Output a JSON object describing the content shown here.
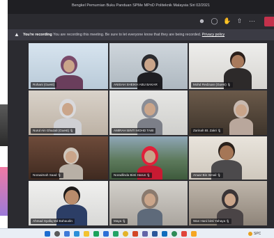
{
  "window": {
    "title": "Bengkel Pemurnian Buku Panduan SPMe MPnD Politeknik Malaysia Siri 02/2021"
  },
  "toolbar": {
    "icons": [
      "people-icon",
      "chat-icon",
      "hand-icon",
      "share-icon",
      "more-icon"
    ]
  },
  "banner": {
    "strong": "You're recording",
    "message": "You are recording this meeting. Be sure to let everyone know that they are being recorded.",
    "link": "Privacy policy"
  },
  "participants": [
    {
      "name": "Rohani (Guest)",
      "muted": false
    },
    {
      "name": "ANISAH SHEIKH ABU BAKAR",
      "muted": false
    },
    {
      "name": "Mohd Redzuan (Guest)",
      "muted": true
    },
    {
      "name": "Nurul Ain Ghazali (Guest)",
      "muted": true
    },
    {
      "name": "AMIRAH BINTI MOHD TAIB",
      "muted": false
    },
    {
      "name": "Zarinah Bt. Zakri",
      "muted": true
    },
    {
      "name": "Noraaimah Saad",
      "muted": true
    },
    {
      "name": "Noradlinda Binti Harun",
      "muted": true
    },
    {
      "name": "Anuar Bin Ismail",
      "muted": true
    },
    {
      "name": "Ahmad Syafiq Md Bahaudin",
      "muted": false
    },
    {
      "name": "Maya",
      "muted": true
    },
    {
      "name": "Wan Hani binti Yahaya",
      "muted": true
    }
  ],
  "colors": {
    "leave": "#c4314b",
    "banner": "#3b3b44",
    "titlebar": "#1f1f23"
  },
  "taskbar": {
    "tray_text": "SPC"
  }
}
